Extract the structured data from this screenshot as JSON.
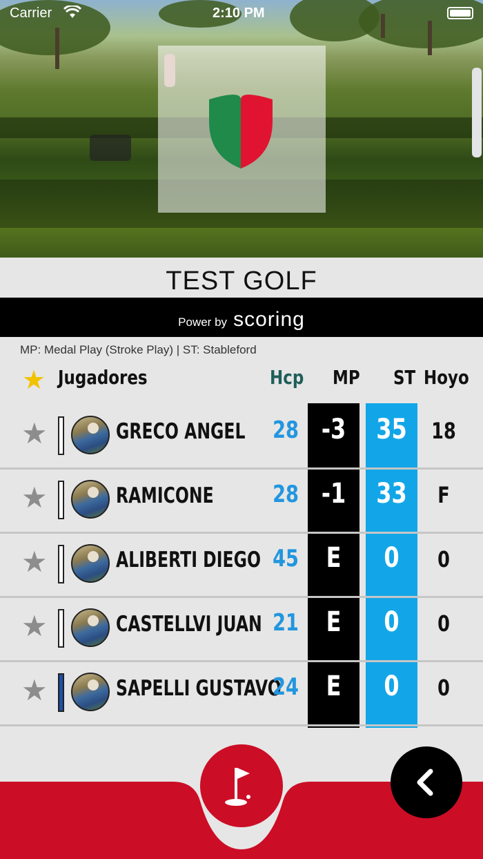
{
  "status_bar": {
    "carrier": "Carrier",
    "time": "2:10 PM"
  },
  "app": {
    "title": "TEST GOLF",
    "powered_by": "Power by",
    "brand": "scoring",
    "legend": "MP: Medal Play (Stroke Play) | ST: Stableford"
  },
  "table": {
    "header": {
      "players": "Jugadores",
      "hcp": "Hcp",
      "mp": "MP",
      "st": "ST",
      "hole": "Hoyo"
    },
    "rows": [
      {
        "name": "GRECO ANGEL",
        "hcp": "28",
        "mp": "-3",
        "st": "35",
        "hole": "18",
        "flag_color": "#ffffff"
      },
      {
        "name": "RAMICONE",
        "hcp": "28",
        "mp": "-1",
        "st": "33",
        "hole": "F",
        "flag_color": "#ffffff"
      },
      {
        "name": "ALIBERTI DIEGO",
        "hcp": "45",
        "mp": "E",
        "st": "0",
        "hole": "0",
        "flag_color": "#ffffff"
      },
      {
        "name": "CASTELLVI JUAN",
        "hcp": "21",
        "mp": "E",
        "st": "0",
        "hole": "0",
        "flag_color": "#ffffff"
      },
      {
        "name": "SAPELLI GUSTAVO",
        "hcp": "24",
        "mp": "E",
        "st": "0",
        "hole": "0",
        "flag_color": "#1e4fa8"
      }
    ]
  },
  "colors": {
    "accent_red": "#cc0d26",
    "stableford_blue": "#12a6e8",
    "hcp_blue": "#2296df",
    "star_yellow": "#f2c200"
  },
  "icons": {
    "favorite": "star-icon",
    "hole": "golf-flag-icon",
    "back": "chevron-left-icon",
    "shield": "club-shield-icon"
  }
}
